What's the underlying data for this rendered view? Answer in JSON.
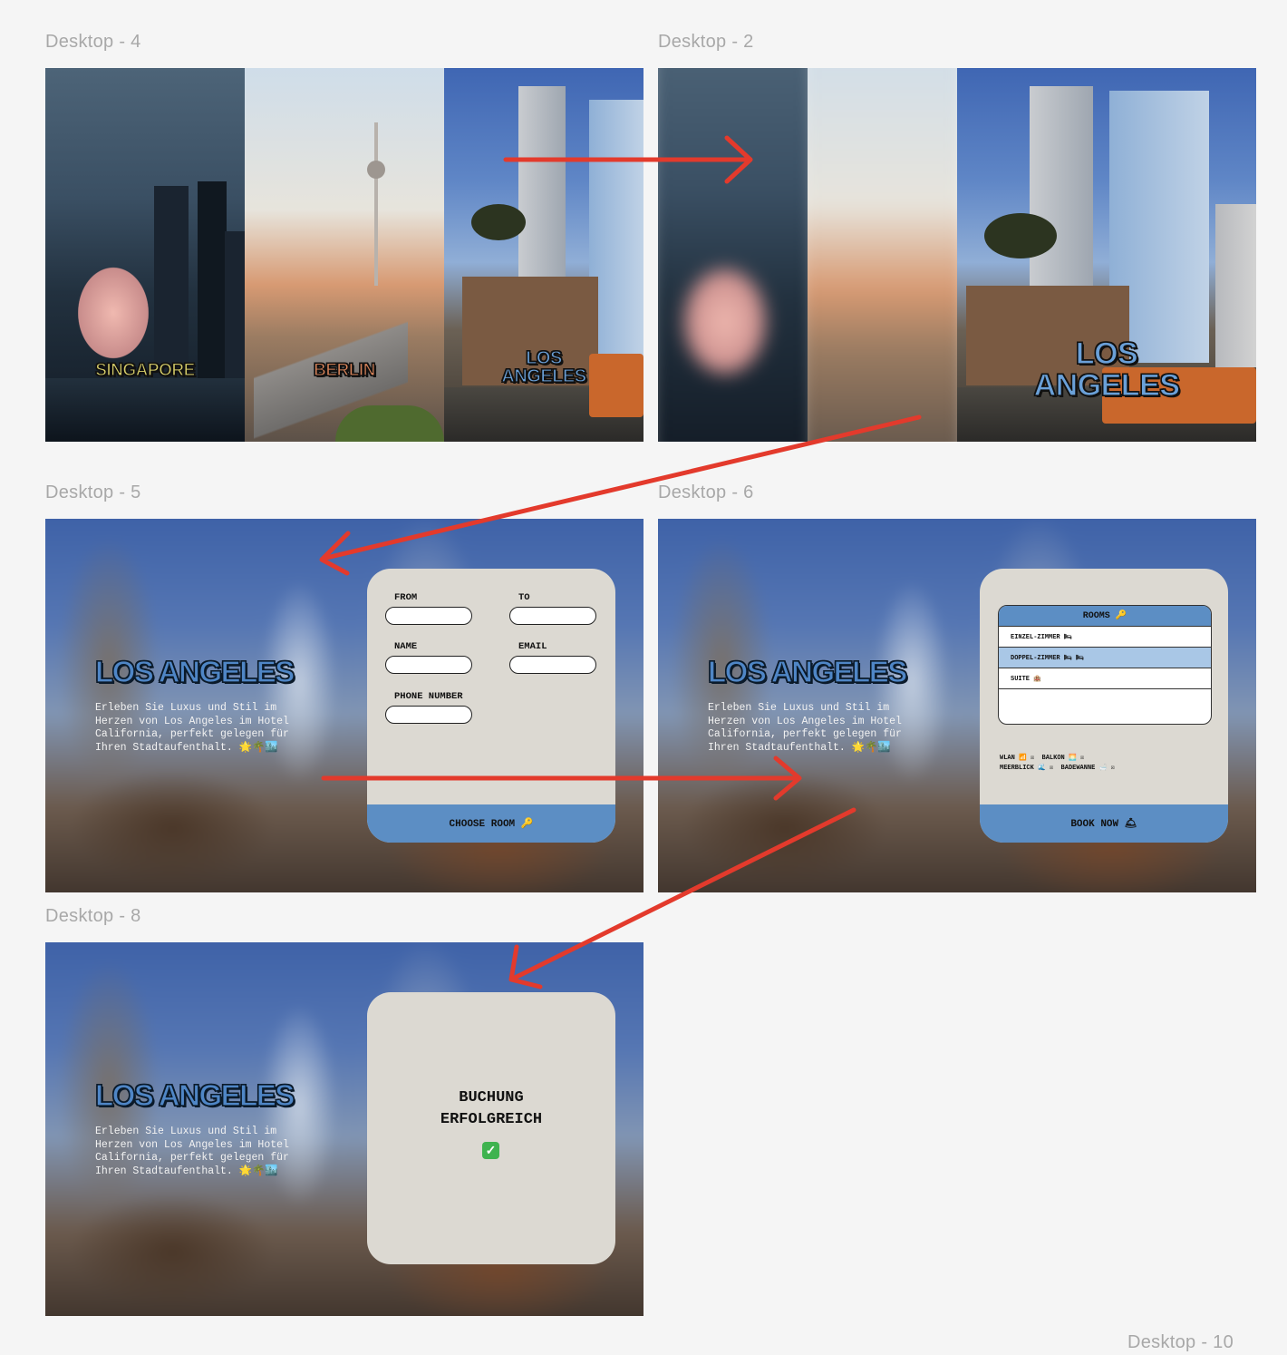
{
  "frames": {
    "d4": "Desktop - 4",
    "d2": "Desktop - 2",
    "d5": "Desktop - 5",
    "d6": "Desktop - 6",
    "d8": "Desktop - 8",
    "d10": "Desktop - 10"
  },
  "cities": {
    "singapore": "SINGAPORE",
    "berlin": "BERLIN",
    "los_angeles_small": "LOS ANGELES",
    "los_angeles_large": "LOS ANGELES"
  },
  "colors": {
    "singapore_label": "#d8cf6a",
    "berlin_label": "#d9845a",
    "la_label": "#6aa0d8",
    "accent_blue": "#5c8ec4",
    "card_bg": "#dcd9d2",
    "arrow": "#e33a2c"
  },
  "hotel": {
    "title": "LOS ANGELES",
    "description": "Erleben Sie Luxus und Stil im Herzen von Los Angeles im Hotel California, perfekt gelegen für Ihren Stadtaufenthalt. 🌟🌴🏙️"
  },
  "booking_form": {
    "from_label": "FROM",
    "to_label": "TO",
    "name_label": "NAME",
    "email_label": "EMAIL",
    "phone_label": "PHONE NUMBER",
    "submit": "CHOOSE ROOM 🔑"
  },
  "room_select": {
    "header": "ROOMS 🔑",
    "rooms": [
      "EINZEL-ZIMMER 🛏",
      "DOPPEL-ZIMMER 🛏 🛏",
      "SUITE 🏨"
    ],
    "selected_index": 1,
    "amenities_line1": "WLAN 📶 ☒  BALKON 🌅 ☒",
    "amenities_line2": "MEERBLICK 🌊 ☒  BADEWANNE 🛁 ☒",
    "submit": "BOOK NOW 🛎"
  },
  "confirmation": {
    "line1": "BUCHUNG",
    "line2": "ERFOLGREICH",
    "icon": "✓"
  }
}
